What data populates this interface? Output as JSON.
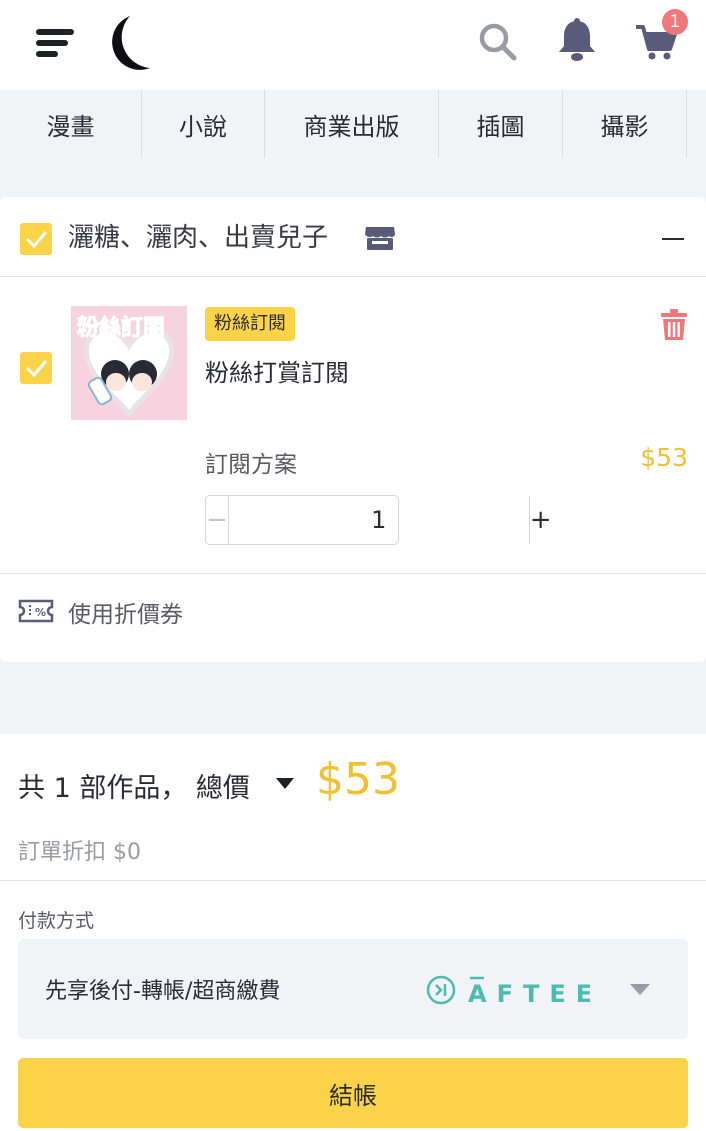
{
  "header": {
    "cart_badge_count": "1",
    "icons": [
      "menu-icon",
      "logo-moon-icon",
      "search-icon",
      "bell-icon",
      "cart-icon"
    ]
  },
  "nav": {
    "tabs": [
      {
        "label": "漫畫"
      },
      {
        "label": "小說"
      },
      {
        "label": "商業出版"
      },
      {
        "label": "插圖"
      },
      {
        "label": "攝影"
      }
    ]
  },
  "cart": {
    "store_name": "灑糖、灑肉、出賣兒子",
    "store_checked": true,
    "item": {
      "checked": true,
      "tag": "粉絲訂閱",
      "name": "粉絲打賞訂閱",
      "plan_label": "訂閱方案",
      "price": "$53",
      "quantity": "1",
      "thumbnail_caption": "粉絲訂閱"
    },
    "coupon_label": "使用折價券"
  },
  "summary": {
    "total_label": "共 1 部作品， 總價",
    "total_amount": "$53",
    "discount_label": "訂單折扣 $0",
    "payment_label": "付款方式",
    "payment_option": "先享後付-轉帳/超商繳費",
    "payment_brand": "AFTEE",
    "checkout_label": "結帳"
  },
  "colors": {
    "accent_yellow": "#fad349",
    "price_gold": "#f0c02f",
    "badge_red": "#f0787d",
    "aftee_teal": "#4bbcb2",
    "background": "#f2f3f7"
  }
}
